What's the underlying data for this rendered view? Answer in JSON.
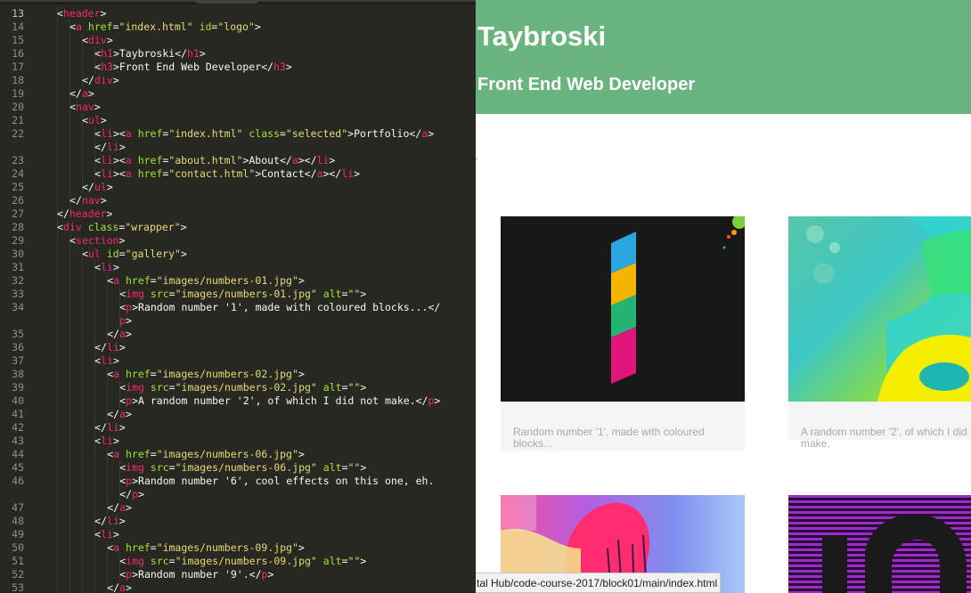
{
  "editor": {
    "line_numbers": [
      "13",
      "14",
      "15",
      "16",
      "17",
      "18",
      "19",
      "20",
      "21",
      "22",
      "",
      "23",
      "24",
      "25",
      "26",
      "27",
      "28",
      "29",
      "30",
      "31",
      "32",
      "33",
      "34",
      "",
      "35",
      "36",
      "37",
      "38",
      "39",
      "40",
      "41",
      "42",
      "43",
      "44",
      "45",
      "46",
      "",
      "47",
      "48",
      "49",
      "50",
      "51",
      "52",
      "53"
    ],
    "lines": [
      {
        "i": 2,
        "t": [
          [
            "p",
            "<"
          ],
          [
            "t",
            "header"
          ],
          [
            "p",
            ">"
          ]
        ]
      },
      {
        "i": 3,
        "t": [
          [
            "p",
            "<"
          ],
          [
            "t",
            "a"
          ],
          [
            "p",
            " "
          ],
          [
            "a",
            "href"
          ],
          [
            "p",
            "="
          ],
          [
            "s",
            "\"index.html\""
          ],
          [
            "p",
            " "
          ],
          [
            "a",
            "id"
          ],
          [
            "p",
            "="
          ],
          [
            "s",
            "\"logo\""
          ],
          [
            "p",
            ">"
          ]
        ]
      },
      {
        "i": 4,
        "t": [
          [
            "p",
            "<"
          ],
          [
            "t",
            "div"
          ],
          [
            "p",
            ">"
          ]
        ]
      },
      {
        "i": 5,
        "t": [
          [
            "p",
            "<"
          ],
          [
            "t",
            "h1"
          ],
          [
            "p",
            ">Taybroski</"
          ],
          [
            "t",
            "h1"
          ],
          [
            "p",
            ">"
          ]
        ]
      },
      {
        "i": 5,
        "t": [
          [
            "p",
            "<"
          ],
          [
            "t",
            "h3"
          ],
          [
            "p",
            ">Front End Web Developer</"
          ],
          [
            "t",
            "h3"
          ],
          [
            "p",
            ">"
          ]
        ]
      },
      {
        "i": 4,
        "t": [
          [
            "p",
            "</"
          ],
          [
            "t",
            "div"
          ],
          [
            "p",
            ">"
          ]
        ]
      },
      {
        "i": 3,
        "t": [
          [
            "p",
            "</"
          ],
          [
            "t",
            "a"
          ],
          [
            "p",
            ">"
          ]
        ]
      },
      {
        "i": 3,
        "t": [
          [
            "p",
            "<"
          ],
          [
            "t",
            "nav"
          ],
          [
            "p",
            ">"
          ]
        ]
      },
      {
        "i": 4,
        "t": [
          [
            "p",
            "<"
          ],
          [
            "t",
            "ul"
          ],
          [
            "p",
            ">"
          ]
        ]
      },
      {
        "i": 5,
        "t": [
          [
            "p",
            "<"
          ],
          [
            "t",
            "li"
          ],
          [
            "p",
            "><"
          ],
          [
            "t",
            "a"
          ],
          [
            "p",
            " "
          ],
          [
            "a",
            "href"
          ],
          [
            "p",
            "="
          ],
          [
            "s",
            "\"index.html\""
          ],
          [
            "p",
            " "
          ],
          [
            "a",
            "class"
          ],
          [
            "p",
            "="
          ],
          [
            "s",
            "\"selected\""
          ],
          [
            "p",
            ">Portfolio</"
          ],
          [
            "t",
            "a"
          ],
          [
            "p",
            ">"
          ]
        ]
      },
      {
        "i": 5,
        "t": [
          [
            "p",
            "</"
          ],
          [
            "t",
            "li"
          ],
          [
            "p",
            ">"
          ]
        ]
      },
      {
        "i": 5,
        "t": [
          [
            "p",
            "<"
          ],
          [
            "t",
            "li"
          ],
          [
            "p",
            "><"
          ],
          [
            "t",
            "a"
          ],
          [
            "p",
            " "
          ],
          [
            "a",
            "href"
          ],
          [
            "p",
            "="
          ],
          [
            "s",
            "\"about.html\""
          ],
          [
            "p",
            ">About</"
          ],
          [
            "t",
            "a"
          ],
          [
            "p",
            "></"
          ],
          [
            "t",
            "li"
          ],
          [
            "p",
            ">"
          ]
        ]
      },
      {
        "i": 5,
        "t": [
          [
            "p",
            "<"
          ],
          [
            "t",
            "li"
          ],
          [
            "p",
            "><"
          ],
          [
            "t",
            "a"
          ],
          [
            "p",
            " "
          ],
          [
            "a",
            "href"
          ],
          [
            "p",
            "="
          ],
          [
            "s",
            "\"contact.html\""
          ],
          [
            "p",
            ">Contact</"
          ],
          [
            "t",
            "a"
          ],
          [
            "p",
            "></"
          ],
          [
            "t",
            "li"
          ],
          [
            "p",
            ">"
          ]
        ]
      },
      {
        "i": 4,
        "t": [
          [
            "p",
            "</"
          ],
          [
            "t",
            "ul"
          ],
          [
            "p",
            ">"
          ]
        ]
      },
      {
        "i": 3,
        "t": [
          [
            "p",
            "</"
          ],
          [
            "t",
            "nav"
          ],
          [
            "p",
            ">"
          ]
        ]
      },
      {
        "i": 2,
        "t": [
          [
            "p",
            "</"
          ],
          [
            "t",
            "header"
          ],
          [
            "p",
            ">"
          ]
        ]
      },
      {
        "i": 2,
        "t": [
          [
            "p",
            "<"
          ],
          [
            "t",
            "div"
          ],
          [
            "p",
            " "
          ],
          [
            "a",
            "class"
          ],
          [
            "p",
            "="
          ],
          [
            "s",
            "\"wrapper\""
          ],
          [
            "p",
            ">"
          ]
        ]
      },
      {
        "i": 3,
        "t": [
          [
            "p",
            "<"
          ],
          [
            "t",
            "section"
          ],
          [
            "p",
            ">"
          ]
        ]
      },
      {
        "i": 4,
        "t": [
          [
            "p",
            "<"
          ],
          [
            "t",
            "ul"
          ],
          [
            "p",
            " "
          ],
          [
            "a",
            "id"
          ],
          [
            "p",
            "="
          ],
          [
            "s",
            "\"gallery\""
          ],
          [
            "p",
            ">"
          ]
        ]
      },
      {
        "i": 5,
        "t": [
          [
            "p",
            "<"
          ],
          [
            "t",
            "li"
          ],
          [
            "p",
            ">"
          ]
        ]
      },
      {
        "i": 6,
        "t": [
          [
            "p",
            "<"
          ],
          [
            "t",
            "a"
          ],
          [
            "p",
            " "
          ],
          [
            "a",
            "href"
          ],
          [
            "p",
            "="
          ],
          [
            "s",
            "\"images/numbers-01.jpg\""
          ],
          [
            "p",
            ">"
          ]
        ]
      },
      {
        "i": 7,
        "t": [
          [
            "p",
            "<"
          ],
          [
            "t",
            "img"
          ],
          [
            "p",
            " "
          ],
          [
            "a",
            "src"
          ],
          [
            "p",
            "="
          ],
          [
            "s",
            "\"images/numbers-01.jpg\""
          ],
          [
            "p",
            " "
          ],
          [
            "a",
            "alt"
          ],
          [
            "p",
            "="
          ],
          [
            "s",
            "\"\""
          ],
          [
            "p",
            ">"
          ]
        ]
      },
      {
        "i": 7,
        "t": [
          [
            "p",
            "<"
          ],
          [
            "t",
            "p"
          ],
          [
            "p",
            ">Random number '1', made with coloured blocks...</"
          ]
        ]
      },
      {
        "i": 7,
        "t": [
          [
            "t",
            "p"
          ],
          [
            "p",
            ">"
          ]
        ]
      },
      {
        "i": 6,
        "t": [
          [
            "p",
            "</"
          ],
          [
            "t",
            "a"
          ],
          [
            "p",
            ">"
          ]
        ]
      },
      {
        "i": 5,
        "t": [
          [
            "p",
            "</"
          ],
          [
            "t",
            "li"
          ],
          [
            "p",
            ">"
          ]
        ]
      },
      {
        "i": 5,
        "t": [
          [
            "p",
            "<"
          ],
          [
            "t",
            "li"
          ],
          [
            "p",
            ">"
          ]
        ]
      },
      {
        "i": 6,
        "t": [
          [
            "p",
            "<"
          ],
          [
            "t",
            "a"
          ],
          [
            "p",
            " "
          ],
          [
            "a",
            "href"
          ],
          [
            "p",
            "="
          ],
          [
            "s",
            "\"images/numbers-02.jpg\""
          ],
          [
            "p",
            ">"
          ]
        ]
      },
      {
        "i": 7,
        "t": [
          [
            "p",
            "<"
          ],
          [
            "t",
            "img"
          ],
          [
            "p",
            " "
          ],
          [
            "a",
            "src"
          ],
          [
            "p",
            "="
          ],
          [
            "s",
            "\"images/numbers-02.jpg\""
          ],
          [
            "p",
            " "
          ],
          [
            "a",
            "alt"
          ],
          [
            "p",
            "="
          ],
          [
            "s",
            "\"\""
          ],
          [
            "p",
            ">"
          ]
        ]
      },
      {
        "i": 7,
        "t": [
          [
            "p",
            "<"
          ],
          [
            "t",
            "p"
          ],
          [
            "p",
            ">A random number '2', of which I did not make.</"
          ],
          [
            "t",
            "p"
          ],
          [
            "p",
            ">"
          ]
        ]
      },
      {
        "i": 6,
        "t": [
          [
            "p",
            "</"
          ],
          [
            "t",
            "a"
          ],
          [
            "p",
            ">"
          ]
        ]
      },
      {
        "i": 5,
        "t": [
          [
            "p",
            "</"
          ],
          [
            "t",
            "li"
          ],
          [
            "p",
            ">"
          ]
        ]
      },
      {
        "i": 5,
        "t": [
          [
            "p",
            "<"
          ],
          [
            "t",
            "li"
          ],
          [
            "p",
            ">"
          ]
        ]
      },
      {
        "i": 6,
        "t": [
          [
            "p",
            "<"
          ],
          [
            "t",
            "a"
          ],
          [
            "p",
            " "
          ],
          [
            "a",
            "href"
          ],
          [
            "p",
            "="
          ],
          [
            "s",
            "\"images/numbers-06.jpg\""
          ],
          [
            "p",
            ">"
          ]
        ]
      },
      {
        "i": 7,
        "t": [
          [
            "p",
            "<"
          ],
          [
            "t",
            "img"
          ],
          [
            "p",
            " "
          ],
          [
            "a",
            "src"
          ],
          [
            "p",
            "="
          ],
          [
            "s",
            "\"images/numbers-06.jpg\""
          ],
          [
            "p",
            " "
          ],
          [
            "a",
            "alt"
          ],
          [
            "p",
            "="
          ],
          [
            "s",
            "\"\""
          ],
          [
            "p",
            ">"
          ]
        ]
      },
      {
        "i": 7,
        "t": [
          [
            "p",
            "<"
          ],
          [
            "t",
            "p"
          ],
          [
            "p",
            ">Random number '6', cool effects on this one, eh."
          ]
        ]
      },
      {
        "i": 7,
        "t": [
          [
            "p",
            "</"
          ],
          [
            "t",
            "p"
          ],
          [
            "p",
            ">"
          ]
        ]
      },
      {
        "i": 6,
        "t": [
          [
            "p",
            "</"
          ],
          [
            "t",
            "a"
          ],
          [
            "p",
            ">"
          ]
        ]
      },
      {
        "i": 5,
        "t": [
          [
            "p",
            "</"
          ],
          [
            "t",
            "li"
          ],
          [
            "p",
            ">"
          ]
        ]
      },
      {
        "i": 5,
        "t": [
          [
            "p",
            "<"
          ],
          [
            "t",
            "li"
          ],
          [
            "p",
            ">"
          ]
        ]
      },
      {
        "i": 6,
        "t": [
          [
            "p",
            "<"
          ],
          [
            "t",
            "a"
          ],
          [
            "p",
            " "
          ],
          [
            "a",
            "href"
          ],
          [
            "p",
            "="
          ],
          [
            "s",
            "\"images/numbers-09.jpg\""
          ],
          [
            "p",
            ">"
          ]
        ]
      },
      {
        "i": 7,
        "t": [
          [
            "p",
            "<"
          ],
          [
            "t",
            "img"
          ],
          [
            "p",
            " "
          ],
          [
            "a",
            "src"
          ],
          [
            "p",
            "="
          ],
          [
            "s",
            "\"images/numbers-09.jpg\""
          ],
          [
            "p",
            " "
          ],
          [
            "a",
            "alt"
          ],
          [
            "p",
            "="
          ],
          [
            "s",
            "\"\""
          ],
          [
            "p",
            ">"
          ]
        ]
      },
      {
        "i": 7,
        "t": [
          [
            "p",
            "<"
          ],
          [
            "t",
            "p"
          ],
          [
            "p",
            ">Random number '9'.</"
          ],
          [
            "t",
            "p"
          ],
          [
            "p",
            ">"
          ]
        ]
      },
      {
        "i": 6,
        "t": [
          [
            "p",
            "</"
          ],
          [
            "t",
            "a"
          ],
          [
            "p",
            ">"
          ]
        ]
      }
    ],
    "colors": {
      "background": "#272822",
      "tag": "#f92672",
      "attribute": "#a6e22e",
      "string": "#e6db74",
      "text": "#f8f8f2",
      "line_number": "#90908a"
    }
  },
  "site": {
    "title": "Taybroski",
    "subtitle": "Front End Web Developer",
    "header_color": "#6ab47f",
    "gallery": [
      {
        "image": "numbers-01-thumbnail",
        "caption": "Random number '1', made with coloured blocks..."
      },
      {
        "image": "numbers-02-thumbnail",
        "caption": "A random number '2', of which I did not make."
      },
      {
        "image": "numbers-06-thumbnail",
        "caption": ""
      },
      {
        "image": "numbers-09-thumbnail",
        "caption": ""
      }
    ]
  },
  "status_bar": {
    "url": "tal Hub/code-course-2017/block01/main/index.html"
  }
}
